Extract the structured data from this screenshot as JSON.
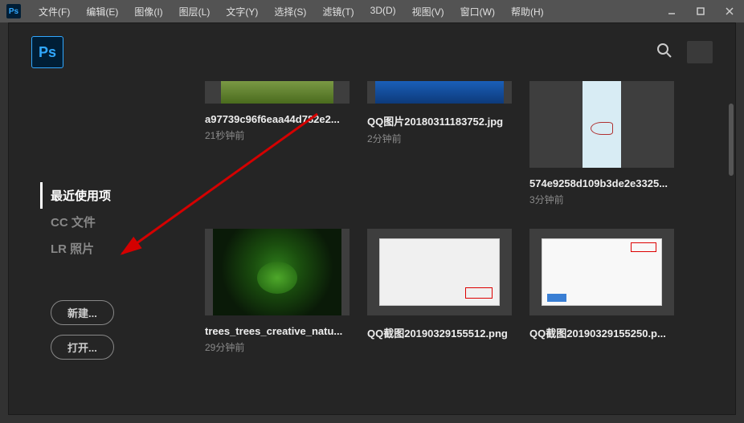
{
  "menubar": {
    "items": [
      "文件(F)",
      "编辑(E)",
      "图像(I)",
      "图层(L)",
      "文字(Y)",
      "选择(S)",
      "滤镜(T)",
      "3D(D)",
      "视图(V)",
      "窗口(W)",
      "帮助(H)"
    ]
  },
  "app_logo": "Ps",
  "sidebar": {
    "tabs": [
      {
        "label": "最近使用项",
        "active": true
      },
      {
        "label": "CC 文件",
        "active": false
      },
      {
        "label": "LR 照片",
        "active": false
      }
    ],
    "new_btn": "新建...",
    "open_btn": "打开..."
  },
  "files": [
    {
      "name": "a97739c96f6eaa44d782e2...",
      "time": "21秒钟前",
      "thumb": "grass",
      "row": "first"
    },
    {
      "name": "QQ图片20180311183752.jpg",
      "time": "2分钟前",
      "thumb": "ocean",
      "row": "first"
    },
    {
      "name": "574e9258d109b3de2e3325...",
      "time": "3分钟前",
      "thumb": "fish",
      "row": ""
    },
    {
      "name": "trees_trees_creative_natu...",
      "time": "29分钟前",
      "thumb": "tree",
      "row": ""
    },
    {
      "name": "QQ截图20190329155512.png",
      "time": "",
      "thumb": "dialog",
      "row": ""
    },
    {
      "name": "QQ截图20190329155250.p...",
      "time": "",
      "thumb": "dialog2",
      "row": ""
    }
  ]
}
